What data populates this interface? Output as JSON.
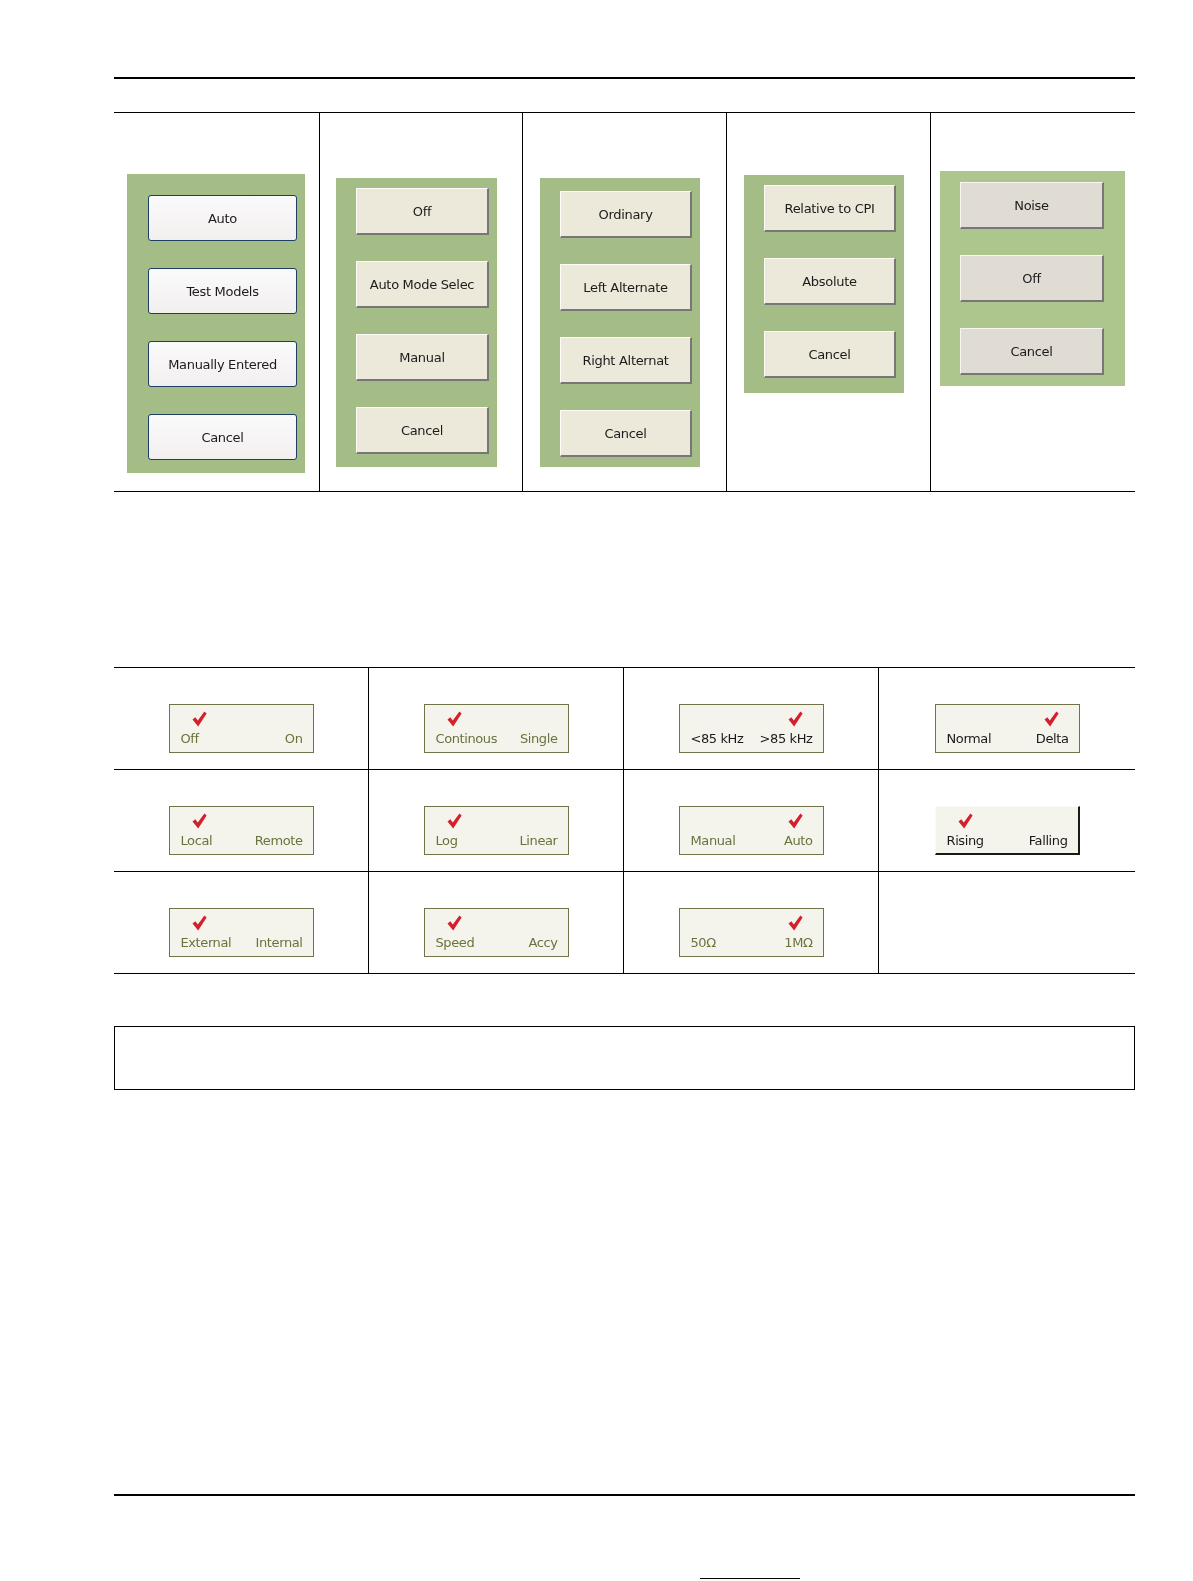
{
  "top_panels": [
    {
      "kind": "rounded",
      "buttons": [
        "Auto",
        "Test Models",
        "Manually Entered",
        "Cancel"
      ]
    },
    {
      "kind": "raised",
      "buttons": [
        "Off",
        "Auto Mode Selec",
        "Manual",
        "Cancel"
      ]
    },
    {
      "kind": "raised",
      "buttons": [
        "Ordinary",
        "Left Alternate",
        "Right Alternat",
        "Cancel"
      ]
    },
    {
      "kind": "raised",
      "buttons": [
        "Relative to CPI",
        "Absolute",
        "Cancel"
      ]
    },
    {
      "kind": "grey",
      "buttons": [
        "Noise",
        "Off",
        "Cancel"
      ]
    }
  ],
  "toggle_grid": {
    "toggles": [
      {
        "kind": "flat",
        "dimmed": true,
        "options": [
          {
            "label": "Off",
            "selected": true
          },
          {
            "label": "On",
            "selected": false
          }
        ]
      },
      {
        "kind": "flat",
        "dimmed": true,
        "options": [
          {
            "label": "Continous",
            "selected": true
          },
          {
            "label": "Single",
            "selected": false
          }
        ]
      },
      {
        "kind": "flat",
        "dimmed": false,
        "options": [
          {
            "label": "<85 kHz",
            "selected": false
          },
          {
            "label": ">85 kHz",
            "selected": true
          }
        ]
      },
      {
        "kind": "flat",
        "dimmed": false,
        "options": [
          {
            "label": "Normal",
            "selected": false
          },
          {
            "label": "Delta",
            "selected": true
          }
        ]
      },
      {
        "kind": "flat",
        "dimmed": true,
        "options": [
          {
            "label": "Local",
            "selected": true
          },
          {
            "label": "Remote",
            "selected": false
          }
        ]
      },
      {
        "kind": "flat",
        "dimmed": true,
        "options": [
          {
            "label": "Log",
            "selected": true
          },
          {
            "label": "Linear",
            "selected": false
          }
        ]
      },
      {
        "kind": "flat",
        "dimmed": true,
        "options": [
          {
            "label": "Manual",
            "selected": false
          },
          {
            "label": "Auto",
            "selected": true
          }
        ]
      },
      {
        "kind": "raised",
        "dimmed": false,
        "options": [
          {
            "label": "Rising",
            "selected": true
          },
          {
            "label": "Falling",
            "selected": false
          }
        ]
      },
      {
        "kind": "flat",
        "dimmed": true,
        "options": [
          {
            "label": "External",
            "selected": true
          },
          {
            "label": "Internal",
            "selected": false
          }
        ]
      },
      {
        "kind": "flat",
        "dimmed": true,
        "options": [
          {
            "label": "Speed",
            "selected": true
          },
          {
            "label": "Accy",
            "selected": false
          }
        ]
      },
      {
        "kind": "flat",
        "dimmed": true,
        "options": [
          {
            "label": "50Ω",
            "selected": false
          },
          {
            "label": "1MΩ",
            "selected": true
          }
        ]
      }
    ]
  }
}
